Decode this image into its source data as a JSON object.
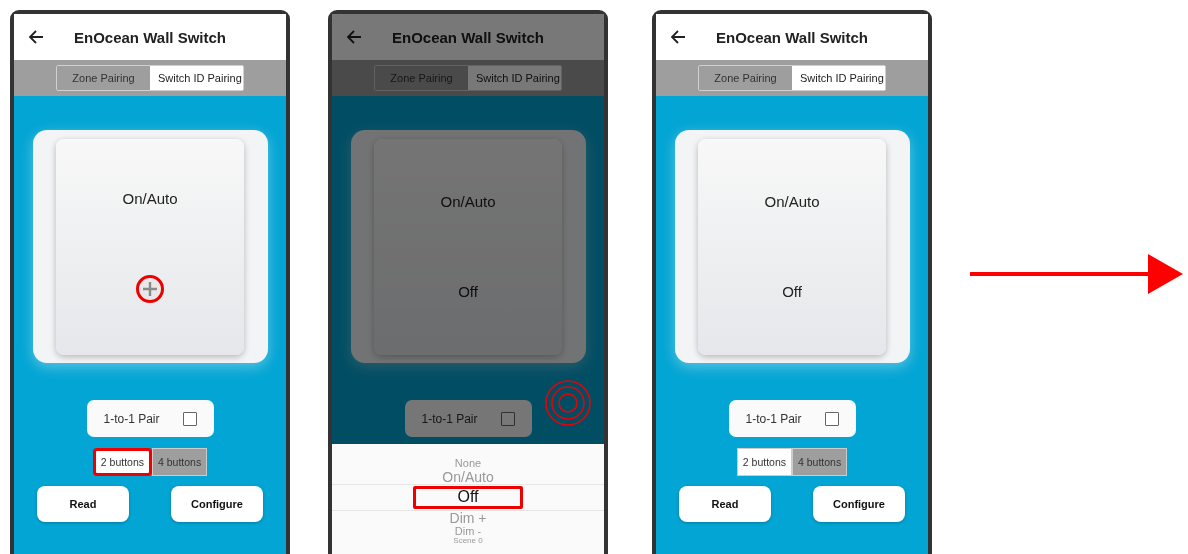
{
  "screens": [
    {
      "title": "EnOcean Wall Switch",
      "dimmed": false,
      "tabs": [
        {
          "label": "Zone Pairing",
          "selected": false
        },
        {
          "label": "Switch ID Pairing",
          "selected": true
        }
      ],
      "switch_buttons": [
        {
          "kind": "label",
          "text": "On/Auto",
          "annotated": false
        },
        {
          "kind": "add",
          "annotated": true
        }
      ],
      "pair": {
        "label": "1-to-1 Pair",
        "checked": false
      },
      "button_count": [
        {
          "label": "2 buttons",
          "selected": true,
          "annotated": true
        },
        {
          "label": "4 buttons",
          "selected": false,
          "annotated": false
        }
      ],
      "actions": [
        "Read",
        "Configure"
      ]
    },
    {
      "title": "EnOcean Wall Switch",
      "dimmed": true,
      "tap_marker": true,
      "tabs": [
        {
          "label": "Zone Pairing",
          "selected": false
        },
        {
          "label": "Switch ID Pairing",
          "selected": true
        }
      ],
      "switch_buttons": [
        {
          "kind": "label",
          "text": "On/Auto",
          "annotated": false
        },
        {
          "kind": "label",
          "text": "Off",
          "annotated": false
        }
      ],
      "pair": {
        "label": "1-to-1 Pair",
        "checked": false
      },
      "picker": [
        {
          "label": "None",
          "selected": false
        },
        {
          "label": "On/Auto",
          "selected": false
        },
        {
          "label": "Off",
          "selected": true,
          "annotated": true
        },
        {
          "label": "Dim +",
          "selected": false
        },
        {
          "label": "Dim -",
          "selected": false
        },
        {
          "label": "Scene 0",
          "selected": false
        }
      ]
    },
    {
      "title": "EnOcean Wall Switch",
      "dimmed": false,
      "tabs": [
        {
          "label": "Zone Pairing",
          "selected": false
        },
        {
          "label": "Switch ID Pairing",
          "selected": true
        }
      ],
      "switch_buttons": [
        {
          "kind": "label",
          "text": "On/Auto",
          "annotated": false
        },
        {
          "kind": "label",
          "text": "Off",
          "annotated": false
        }
      ],
      "pair": {
        "label": "1-to-1 Pair",
        "checked": false
      },
      "button_count": [
        {
          "label": "2 buttons",
          "selected": true,
          "annotated": false
        },
        {
          "label": "4 buttons",
          "selected": false,
          "annotated": false
        }
      ],
      "actions": [
        "Read",
        "Configure"
      ]
    }
  ]
}
